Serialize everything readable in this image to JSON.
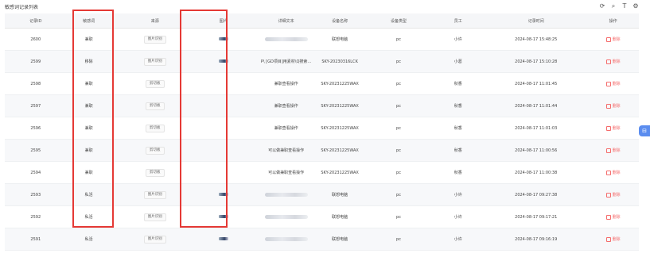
{
  "page": {
    "title": "敏感词记录列表"
  },
  "tools": [
    {
      "name": "refresh-icon",
      "glyph": "⟳"
    },
    {
      "name": "search-icon",
      "glyph": "⌕"
    },
    {
      "name": "column-height-icon",
      "glyph": "T"
    },
    {
      "name": "settings-icon",
      "glyph": "⚙"
    }
  ],
  "columns": [
    "记录ID",
    "敏感词",
    "来源",
    "图片",
    "详细文本",
    "设备名称",
    "设备类型",
    "员工",
    "记录时间",
    "操作"
  ],
  "rows": [
    {
      "id": "2600",
      "word": "兼职",
      "source": "图片识别",
      "image": true,
      "detail": "",
      "device": "联想电脑",
      "type": "pc",
      "employee": "小许",
      "time": "2024-08-17 15:48:25",
      "op": "删除"
    },
    {
      "id": "2599",
      "word": "移除",
      "source": "图片识别",
      "image": true,
      "detail": "P\\ [GD项目]用素材\\Q搜索…",
      "device": "SKY-20230316LCK",
      "type": "pc",
      "employee": "小葛",
      "time": "2024-08-17 15:10:28",
      "op": "删除"
    },
    {
      "id": "2598",
      "word": "兼职",
      "source": "剪切板",
      "image": false,
      "detail": "兼职查看操作",
      "device": "SKY-20231225WAX",
      "type": "pc",
      "employee": "秋香",
      "time": "2024-08-17 11:01:45",
      "op": "删除"
    },
    {
      "id": "2597",
      "word": "兼职",
      "source": "剪切板",
      "image": false,
      "detail": "兼职查看操作",
      "device": "SKY-20231225WAX",
      "type": "pc",
      "employee": "秋香",
      "time": "2024-08-17 11:01:44",
      "op": "删除"
    },
    {
      "id": "2596",
      "word": "兼职",
      "source": "剪切板",
      "image": false,
      "detail": "兼职查看操作",
      "device": "SKY-20231225WAX",
      "type": "pc",
      "employee": "秋香",
      "time": "2024-08-17 11:01:03",
      "op": "删除"
    },
    {
      "id": "2595",
      "word": "兼职",
      "source": "剪切板",
      "image": false,
      "detail": "可以做兼职查看操作",
      "device": "SKY-20231225WAX",
      "type": "pc",
      "employee": "秋香",
      "time": "2024-08-17 11:00:56",
      "op": "删除"
    },
    {
      "id": "2594",
      "word": "兼职",
      "source": "剪切板",
      "image": false,
      "detail": "可以做兼职查看操作",
      "device": "SKY-20231225WAX",
      "type": "pc",
      "employee": "秋香",
      "time": "2024-08-17 11:00:38",
      "op": "删除"
    },
    {
      "id": "2593",
      "word": "私活",
      "source": "图片识别",
      "image": true,
      "detail": "",
      "device": "联想电脑",
      "type": "pc",
      "employee": "小许",
      "time": "2024-08-17 09:27:38",
      "op": "删除"
    },
    {
      "id": "2592",
      "word": "私活",
      "source": "图片识别",
      "image": true,
      "detail": "",
      "device": "联想电脑",
      "type": "pc",
      "employee": "小许",
      "time": "2024-08-17 09:17:21",
      "op": "删除"
    },
    {
      "id": "2591",
      "word": "私活",
      "source": "图片识别",
      "image": true,
      "detail": "",
      "device": "联想电脑",
      "type": "pc",
      "employee": "小许",
      "time": "2024-08-17 09:16:19",
      "op": "删除"
    }
  ],
  "float_button": {
    "glyph": "⊟"
  }
}
